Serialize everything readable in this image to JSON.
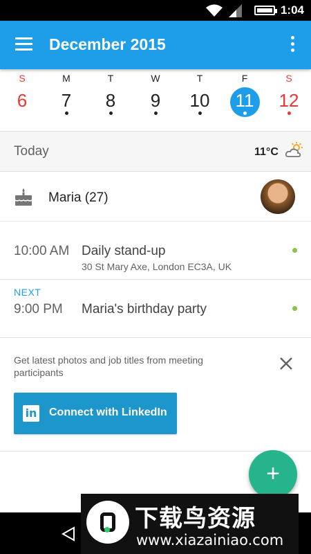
{
  "status_bar": {
    "time": "1:04"
  },
  "app_bar": {
    "title": "December 2015"
  },
  "week": {
    "days": [
      {
        "name": "S",
        "number": "6",
        "weekend": true,
        "has_event": false,
        "selected": false
      },
      {
        "name": "M",
        "number": "7",
        "weekend": false,
        "has_event": true,
        "selected": false
      },
      {
        "name": "T",
        "number": "8",
        "weekend": false,
        "has_event": true,
        "selected": false
      },
      {
        "name": "W",
        "number": "9",
        "weekend": false,
        "has_event": true,
        "selected": false
      },
      {
        "name": "T",
        "number": "10",
        "weekend": false,
        "has_event": true,
        "selected": false
      },
      {
        "name": "F",
        "number": "11",
        "weekend": false,
        "has_event": true,
        "selected": true
      },
      {
        "name": "S",
        "number": "12",
        "weekend": true,
        "has_event": true,
        "selected": false
      }
    ]
  },
  "today": {
    "label": "Today",
    "temperature": "11°C",
    "weather_icon": "partly-cloudy-icon"
  },
  "birthday": {
    "name": "Maria (27)",
    "icon": "cake-icon"
  },
  "events": [
    {
      "time": "10:00 AM",
      "title": "Daily stand-up",
      "location": "30 St Mary Axe, London EC3A, UK",
      "next_label": ""
    },
    {
      "time": "9:00 PM",
      "title": "Maria's birthday party",
      "location": "",
      "next_label": "NEXT"
    }
  ],
  "promo": {
    "text": "Get latest photos and job titles from meeting participants",
    "button_label": "Connect with LinkedIn",
    "logo_text": "in"
  },
  "fab": {
    "label": "+"
  },
  "watermark": {
    "title": "下载鸟资源",
    "url": "www.xiazainiao.com"
  },
  "colors": {
    "primary": "#1e9ee8",
    "weekend": "#e53935",
    "event_dot": "#8bc34a",
    "fab": "#26b48c",
    "linkedin": "#1d96cc"
  }
}
